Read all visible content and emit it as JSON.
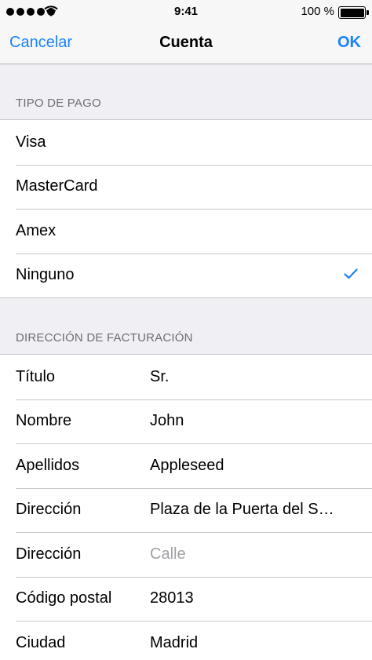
{
  "status_bar": {
    "time": "9:41",
    "battery_percent": "100 %",
    "battery_level": 1.0,
    "signal_bars": 5
  },
  "nav": {
    "cancel_label": "Cancelar",
    "title": "Cuenta",
    "ok_label": "OK"
  },
  "payment": {
    "header": "TIPO DE PAGO",
    "options": [
      "Visa",
      "MasterCard",
      "Amex",
      "Ninguno"
    ],
    "selected": "Ninguno"
  },
  "billing": {
    "header": "DIRECCIÓN DE FACTURACIÓN",
    "fields": [
      {
        "label": "Título",
        "value": "Sr."
      },
      {
        "label": "Nombre",
        "value": "John"
      },
      {
        "label": "Apellidos",
        "value": "Appleseed"
      },
      {
        "label": "Dirección",
        "value": "Plaza de la Puerta del S…"
      },
      {
        "label": "Dirección",
        "placeholder": "Calle"
      },
      {
        "label": "Código postal",
        "value": "28013"
      },
      {
        "label": "Ciudad",
        "value": "Madrid"
      }
    ]
  },
  "colors": {
    "accent": "#1a82fb",
    "background": "#efeff4",
    "separator": "#c8c7cc"
  }
}
